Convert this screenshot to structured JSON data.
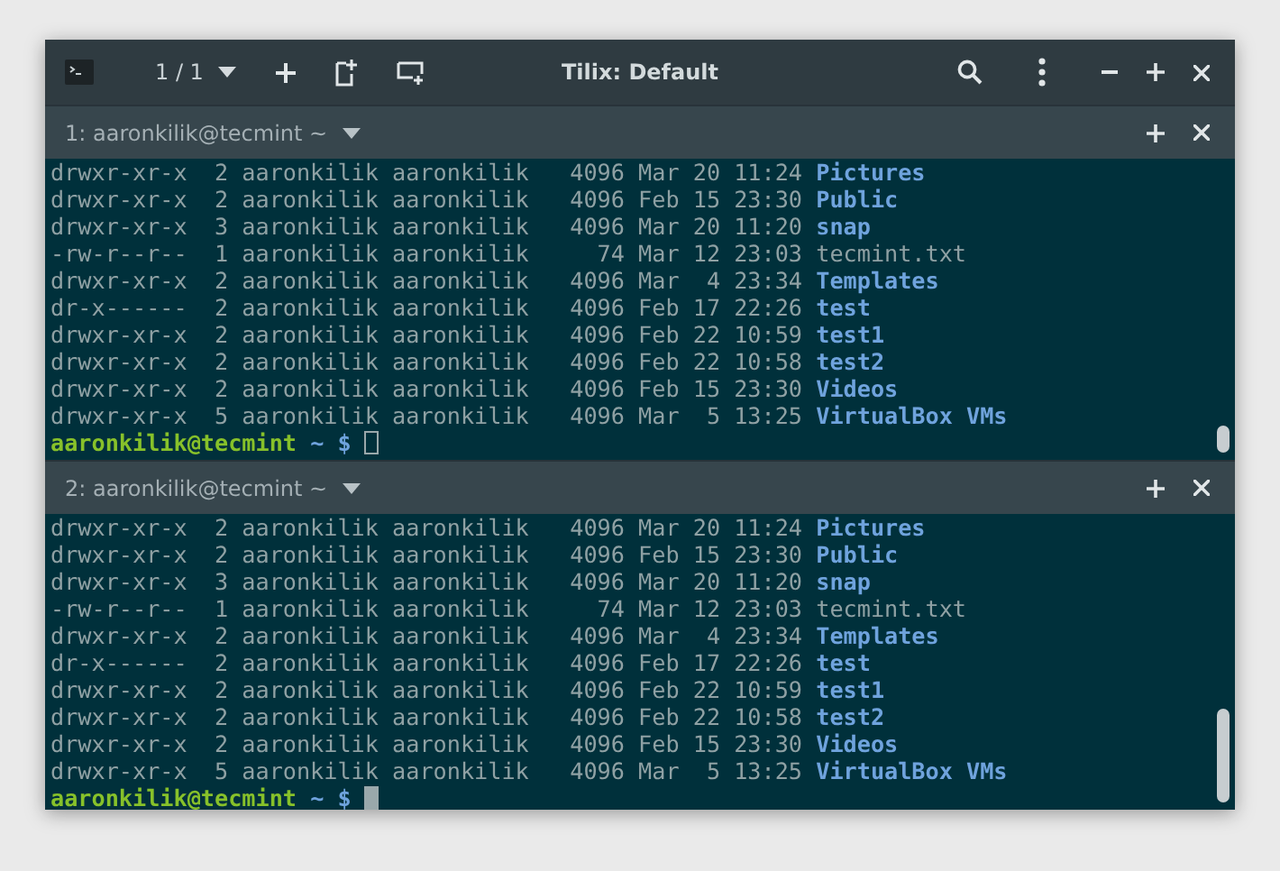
{
  "header": {
    "session_count": "1 / 1",
    "title": "Tilix: Default"
  },
  "panes": [
    {
      "title": "1: aaronkilik@tecmint ~",
      "focused": false,
      "lines": [
        {
          "info": "drwxr-xr-x  2 aaronkilik aaronkilik   4096 Mar 20 11:24",
          "name": "Pictures",
          "kind": "dir"
        },
        {
          "info": "drwxr-xr-x  2 aaronkilik aaronkilik   4096 Feb 15 23:30",
          "name": "Public",
          "kind": "dir"
        },
        {
          "info": "drwxr-xr-x  3 aaronkilik aaronkilik   4096 Mar 20 11:20",
          "name": "snap",
          "kind": "dir"
        },
        {
          "info": "-rw-r--r--  1 aaronkilik aaronkilik     74 Mar 12 23:03",
          "name": "tecmint.txt",
          "kind": "file"
        },
        {
          "info": "drwxr-xr-x  2 aaronkilik aaronkilik   4096 Mar  4 23:34",
          "name": "Templates",
          "kind": "dir"
        },
        {
          "info": "dr-x------  2 aaronkilik aaronkilik   4096 Feb 17 22:26",
          "name": "test",
          "kind": "dir"
        },
        {
          "info": "drwxr-xr-x  2 aaronkilik aaronkilik   4096 Feb 22 10:59",
          "name": "test1",
          "kind": "dir"
        },
        {
          "info": "drwxr-xr-x  2 aaronkilik aaronkilik   4096 Feb 22 10:58",
          "name": "test2",
          "kind": "dir"
        },
        {
          "info": "drwxr-xr-x  2 aaronkilik aaronkilik   4096 Feb 15 23:30",
          "name": "Videos",
          "kind": "dir"
        },
        {
          "info": "drwxr-xr-x  5 aaronkilik aaronkilik   4096 Mar  5 13:25",
          "name": "VirtualBox VMs",
          "kind": "dir"
        }
      ],
      "prompt": {
        "user": "aaronkilik@tecmint",
        "path": "~ $"
      }
    },
    {
      "title": "2: aaronkilik@tecmint ~",
      "focused": true,
      "lines": [
        {
          "info": "drwxr-xr-x  2 aaronkilik aaronkilik   4096 Mar 20 11:24",
          "name": "Pictures",
          "kind": "dir"
        },
        {
          "info": "drwxr-xr-x  2 aaronkilik aaronkilik   4096 Feb 15 23:30",
          "name": "Public",
          "kind": "dir"
        },
        {
          "info": "drwxr-xr-x  3 aaronkilik aaronkilik   4096 Mar 20 11:20",
          "name": "snap",
          "kind": "dir"
        },
        {
          "info": "-rw-r--r--  1 aaronkilik aaronkilik     74 Mar 12 23:03",
          "name": "tecmint.txt",
          "kind": "file"
        },
        {
          "info": "drwxr-xr-x  2 aaronkilik aaronkilik   4096 Mar  4 23:34",
          "name": "Templates",
          "kind": "dir"
        },
        {
          "info": "dr-x------  2 aaronkilik aaronkilik   4096 Feb 17 22:26",
          "name": "test",
          "kind": "dir"
        },
        {
          "info": "drwxr-xr-x  2 aaronkilik aaronkilik   4096 Feb 22 10:59",
          "name": "test1",
          "kind": "dir"
        },
        {
          "info": "drwxr-xr-x  2 aaronkilik aaronkilik   4096 Feb 22 10:58",
          "name": "test2",
          "kind": "dir"
        },
        {
          "info": "drwxr-xr-x  2 aaronkilik aaronkilik   4096 Feb 15 23:30",
          "name": "Videos",
          "kind": "dir"
        },
        {
          "info": "drwxr-xr-x  5 aaronkilik aaronkilik   4096 Mar  5 13:25",
          "name": "VirtualBox VMs",
          "kind": "dir"
        }
      ],
      "prompt": {
        "user": "aaronkilik@tecmint",
        "path": "~ $"
      }
    }
  ]
}
